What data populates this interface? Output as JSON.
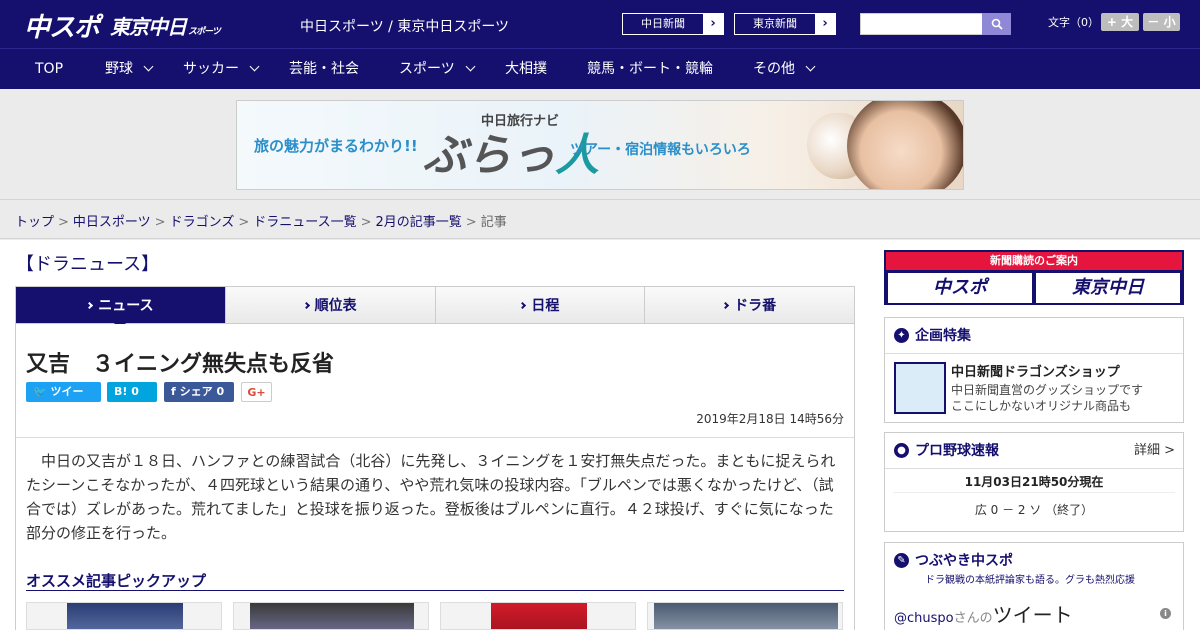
{
  "header": {
    "logo_chuspo": "中スポ",
    "logo_tokyo": "東京中日",
    "logo_tokyo_small": "スポーツ",
    "site_title": "中日スポーツ / 東京中日スポーツ",
    "paper_links": [
      {
        "label": "中日新聞",
        "arrow": "›"
      },
      {
        "label": "東京新聞",
        "arrow": "›"
      }
    ],
    "search_placeholder": "",
    "fontsize_label": "文字（0）",
    "fontsize_plus": "+ 大",
    "fontsize_minus": "－ 小"
  },
  "nav": [
    {
      "label": "TOP",
      "has_dropdown": false
    },
    {
      "label": "野球",
      "has_dropdown": true
    },
    {
      "label": "サッカー",
      "has_dropdown": true
    },
    {
      "label": "芸能・社会",
      "has_dropdown": false
    },
    {
      "label": "スポーツ",
      "has_dropdown": true
    },
    {
      "label": "大相撲",
      "has_dropdown": false
    },
    {
      "label": "競馬・ボート・競輪",
      "has_dropdown": false
    },
    {
      "label": "その他",
      "has_dropdown": true
    }
  ],
  "banner": {
    "left_text": "旅の魅力がまるわかり!!",
    "sub_text": "中日旅行ナビ",
    "logo_a": "ぶらっ",
    "logo_b": "人",
    "right_text": "ツアー・宿泊情報もいろいろ"
  },
  "breadcrumb": {
    "items": [
      "トップ",
      "中日スポーツ",
      "ドラゴンズ",
      "ドラニュース一覧",
      "2月の記事一覧"
    ],
    "current": "記事",
    "separator": ">"
  },
  "section_heading": "【ドラニュース】",
  "tabs": [
    {
      "label": "ニュース",
      "active": true
    },
    {
      "label": "順位表",
      "active": false
    },
    {
      "label": "日程",
      "active": false
    },
    {
      "label": "ドラ番",
      "active": false
    }
  ],
  "article": {
    "title": "又吉　３イニング無失点も反省",
    "share": {
      "twitter": "ツイート",
      "hatena_count": "0",
      "facebook": "シェア 0",
      "gplus": "G+"
    },
    "date": "2019年2月18日 14時56分",
    "body": "中日の又吉が１８日、ハンファとの練習試合（北谷）に先発し、３イニングを１安打無失点だった。まともに捉えられたシーンこそなかったが、４四死球という結果の通り、やや荒れ気味の投球内容。「ブルペンでは悪くなかったけど、（試合では）ズレがあった。荒れてました」と投球を振り返った。登板後はブルペンに直行。４２球投げ、すぐに気になった部分の修正を行った。"
  },
  "pickup": {
    "heading": "オススメ記事ピックアップ"
  },
  "sidebar": {
    "subscribe_label": "新聞購読のご案内",
    "subscribe_chuspo": "中スポ",
    "subscribe_tokyo": "東京中日",
    "special": {
      "heading": "企画特集",
      "shop_title": "中日新聞ドラゴンズショップ",
      "shop_desc_1": "中日新聞直営のグッズショップです",
      "shop_desc_2": "ここにしかないオリジナル商品も"
    },
    "baseball": {
      "heading": "プロ野球速報",
      "more": "詳細 >",
      "time": "11月03日21時50分現在",
      "score": "広 0 － 2 ソ （終了）"
    },
    "tweet": {
      "heading": "つぶやき中スポ",
      "sub": "ドラ観戦の本紙評論家も語る。グラも熱烈応援",
      "handle": "@chuspo",
      "handle_suffix": "さんの",
      "tweet_word": "ツイート"
    }
  },
  "colors": {
    "brand_navy": "#15106e",
    "accent_red": "#e5153d",
    "twitter": "#1da1f2",
    "hatena": "#00a4de",
    "facebook": "#3b5998"
  }
}
